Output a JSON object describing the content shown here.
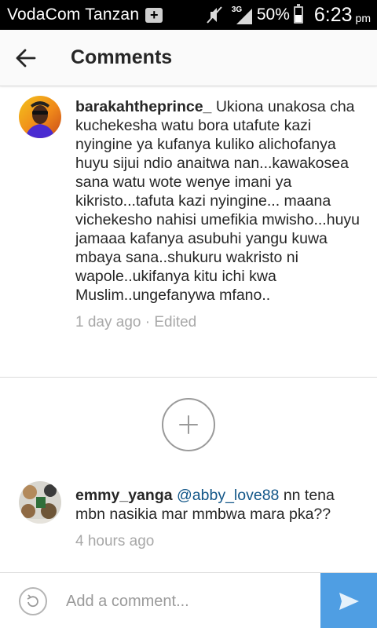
{
  "status_bar": {
    "carrier": "VodaCom Tanzan",
    "network_type": "3G",
    "battery_percent": "50%",
    "battery_level": 0.5,
    "time": "6:23",
    "ampm": "pm",
    "icons": [
      "notification-plus-icon",
      "mute-icon",
      "signal-icon",
      "battery-icon"
    ]
  },
  "header": {
    "title": "Comments",
    "back_icon": "arrow-left-icon"
  },
  "comments": [
    {
      "username": "barakahtheprince_",
      "mention": "",
      "text": "Ukiona unakosa cha kuchekesha watu bora utafute kazi nyingine ya kufanya kuliko alichofanya huyu sijui ndio anaitwa nan...kawakosea sana watu wote wenye imani ya kikristo...tafuta kazi nyingine... maana vichekesho nahisi umefikia mwisho...huyu jamaaa kafanya asubuhi yangu kuwa mbaya sana..shukuru wakristo ni wapole..ukifanya kitu ichi kwa Muslim..ungefanywa mfano..",
      "time": "1 day ago",
      "separator": " · ",
      "status": "Edited"
    },
    {
      "username": "emmy_yanga",
      "mention": "@abby_love88",
      "text": "nn tena mbn nasikia mar mmbwa mara pka??",
      "time": "4 hours ago"
    }
  ],
  "load_more_icon": "plus-icon",
  "composer": {
    "placeholder": "Add a comment...",
    "camera_icon": "camera-icon",
    "send_icon": "send-icon"
  },
  "colors": {
    "status_bar": "#000000",
    "header_bg": "#fafafa",
    "mention": "#125688",
    "meta": "#a8a8a8",
    "send_button": "#4f9ee3"
  }
}
